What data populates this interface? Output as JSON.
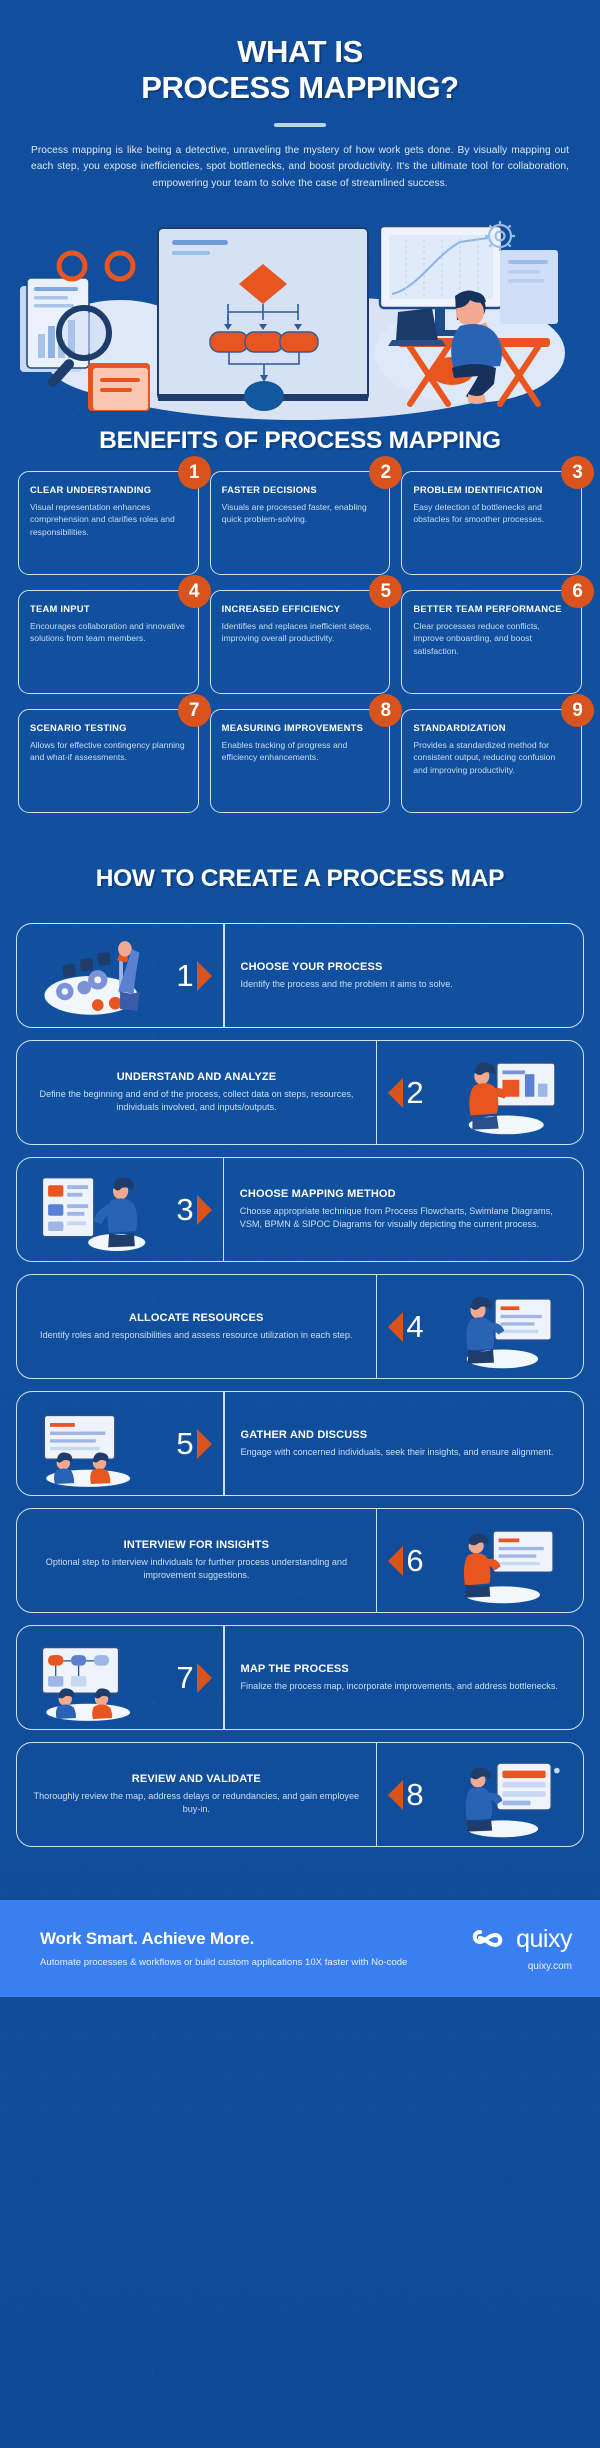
{
  "hero": {
    "title_line1": "WHAT IS",
    "title_line2": "PROCESS MAPPING?",
    "description": "Process mapping is like being a detective, unraveling the mystery of how work gets done. By visually mapping out each step, you expose inefficiencies, spot bottlenecks, and boost productivity. It's the ultimate tool for collaboration, empowering your team to solve the case of streamlined success."
  },
  "benefits": {
    "title": "BENEFITS OF PROCESS MAPPING",
    "items": [
      {
        "number": "1",
        "title": "CLEAR UNDERSTANDING",
        "text": "Visual representation enhances comprehension and clarifies roles and responsibilities."
      },
      {
        "number": "2",
        "title": "FASTER DECISIONS",
        "text": "Visuals are processed faster, enabling quick problem-solving."
      },
      {
        "number": "3",
        "title": "PROBLEM IDENTIFICATION",
        "text": "Easy detection of bottlenecks and obstacles for smoother processes."
      },
      {
        "number": "4",
        "title": "TEAM INPUT",
        "text": "Encourages collaboration and innovative solutions from team members."
      },
      {
        "number": "5",
        "title": "INCREASED EFFICIENCY",
        "text": "Identifies and replaces inefficient steps, improving overall productivity."
      },
      {
        "number": "6",
        "title": "BETTER TEAM PERFORMANCE",
        "text": "Clear processes reduce conflicts, improve onboarding, and boost satisfaction."
      },
      {
        "number": "7",
        "title": "SCENARIO TESTING",
        "text": "Allows for effective contingency planning and what-if assessments."
      },
      {
        "number": "8",
        "title": "MEASURING IMPROVEMENTS",
        "text": "Enables tracking of progress and efficiency enhancements."
      },
      {
        "number": "9",
        "title": "STANDARDIZATION",
        "text": "Provides a standardized method for consistent output, reducing confusion and improving productivity."
      }
    ]
  },
  "steps": {
    "title": "HOW TO CREATE A PROCESS MAP",
    "items": [
      {
        "number": "1",
        "title": "CHOOSE YOUR PROCESS",
        "text": "Identify the process and the problem it aims to solve.",
        "align": "art-left"
      },
      {
        "number": "2",
        "title": "UNDERSTAND AND ANALYZE",
        "text": "Define the beginning and end of the process, collect data on steps, resources, individuals involved, and inputs/outputs.",
        "align": "art-right"
      },
      {
        "number": "3",
        "title": "CHOOSE MAPPING METHOD",
        "text": "Choose appropriate technique from Process Flowcharts, Swimlane Diagrams, VSM, BPMN & SIPOC Diagrams for visually depicting the current process.",
        "align": "art-left"
      },
      {
        "number": "4",
        "title": "ALLOCATE RESOURCES",
        "text": "Identify roles and responsibilities and assess resource utilization in each step.",
        "align": "art-right"
      },
      {
        "number": "5",
        "title": "GATHER AND DISCUSS",
        "text": "Engage with concerned individuals, seek their insights, and ensure alignment.",
        "align": "art-left"
      },
      {
        "number": "6",
        "title": "INTERVIEW FOR INSIGHTS",
        "text": "Optional step to interview individuals for further process understanding and improvement suggestions.",
        "align": "art-right"
      },
      {
        "number": "7",
        "title": "MAP THE PROCESS",
        "text": "Finalize the process map, incorporate improvements, and address bottlenecks.",
        "align": "art-left"
      },
      {
        "number": "8",
        "title": "REVIEW AND VALIDATE",
        "text": "Thoroughly review the map, address delays or redundancies, and gain employee buy-in.",
        "align": "art-right"
      }
    ]
  },
  "footer": {
    "headline": "Work Smart. Achieve More.",
    "subline": "Automate processes & workflows or build custom applications 10X faster with No-code",
    "brand_name": "quixy",
    "brand_url": "quixy.com"
  },
  "colors": {
    "background": "#11509f",
    "accent_orange": "#d9541d",
    "card_border": "#cfdff0",
    "footer_blue": "#3a7ff2",
    "body_text": "#c9dcf1"
  }
}
